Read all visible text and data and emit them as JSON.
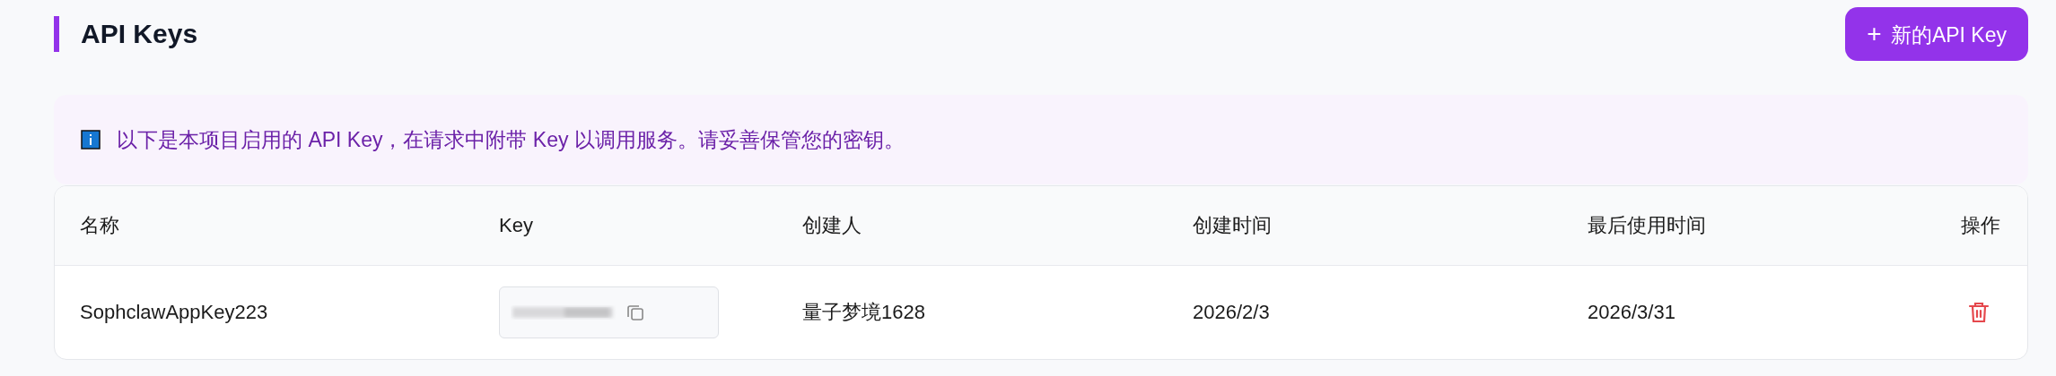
{
  "header": {
    "title": "API Keys",
    "new_button": {
      "icon": "+",
      "label": "新的API Key"
    }
  },
  "notice": {
    "text": "以下是本项目启用的 API Key，在请求中附带 Key 以调用服务。请妥善保管您的密钥。"
  },
  "table": {
    "columns": [
      "名称",
      "Key",
      "创建人",
      "创建时间",
      "最后使用时间",
      "操作"
    ],
    "rows": [
      {
        "name": "SophclawAppKey223",
        "creator": "量子梦境1628",
        "created": "2026/2/3",
        "last_used": "2026/3/31"
      }
    ]
  }
}
